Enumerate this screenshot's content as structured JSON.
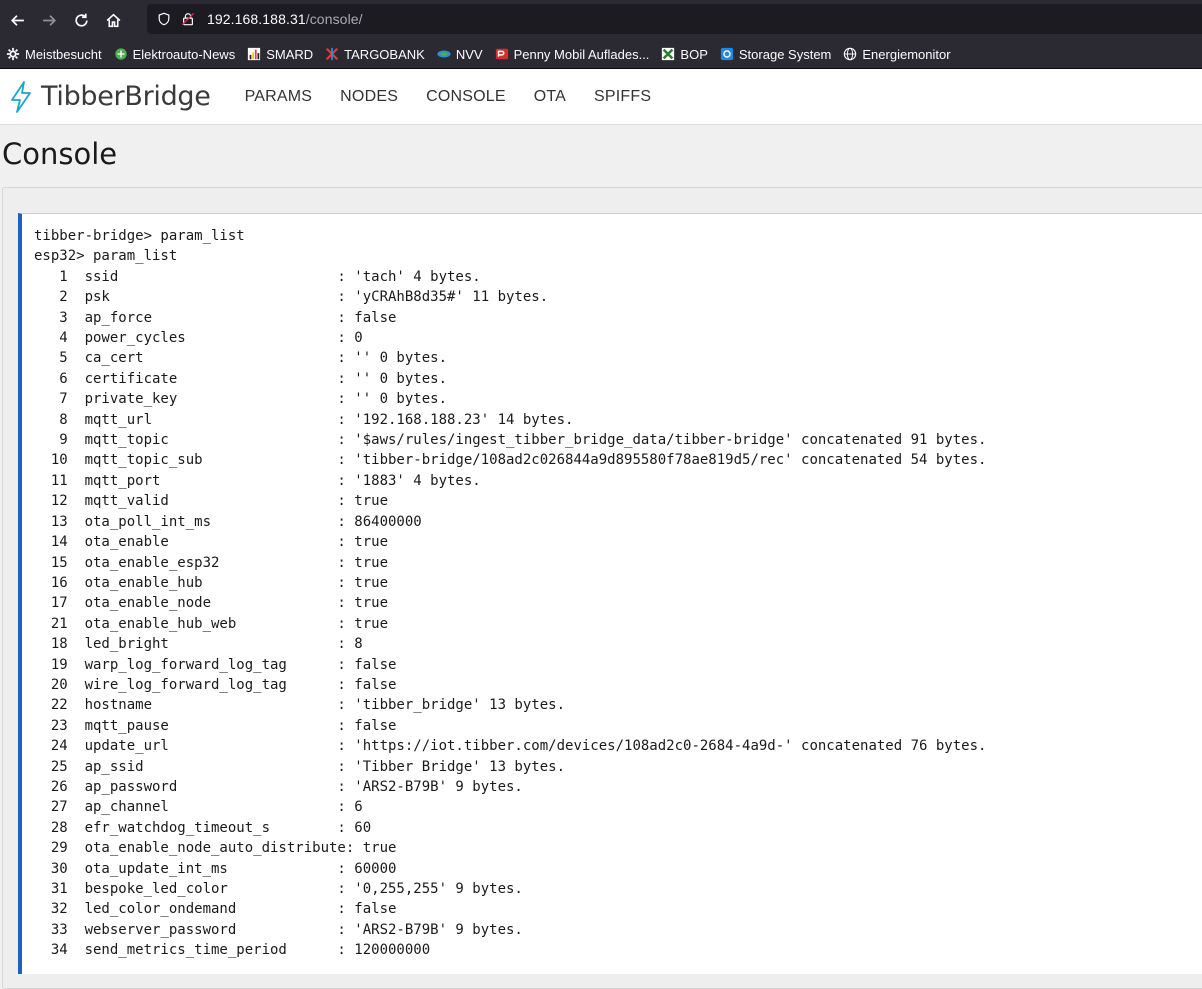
{
  "browser": {
    "url_host": "192.168.188.31",
    "url_path": "/console/",
    "bookmarks": [
      {
        "label": "Meistbesucht",
        "icon": "gear-icon",
        "color": "#fbfbfe"
      },
      {
        "label": "Elektroauto-News",
        "icon": "globe-icon",
        "color": "#4caf50"
      },
      {
        "label": "SMARD",
        "icon": "chart-icon",
        "color": "#f5c518"
      },
      {
        "label": "TARGOBANK",
        "icon": "bank-icon",
        "color": "#e23c3c"
      },
      {
        "label": "NVV",
        "icon": "bus-icon",
        "color": "#2a8fd8"
      },
      {
        "label": "Penny Mobil Auflades...",
        "icon": "penny-icon",
        "color": "#d32f2f"
      },
      {
        "label": "BOP",
        "icon": "bop-icon",
        "color": "#2e7d32"
      },
      {
        "label": "Storage System",
        "icon": "storage-icon",
        "color": "#1e88e5"
      },
      {
        "label": "Energiemonitor",
        "icon": "globe-icon",
        "color": "#fbfbfe"
      }
    ]
  },
  "app": {
    "brand": "TibberBridge",
    "nav": [
      "PARAMS",
      "NODES",
      "CONSOLE",
      "OTA",
      "SPIFFS"
    ],
    "page_title": "Console"
  },
  "console": {
    "lines": [
      "tibber-bridge> param_list",
      "esp32> param_list",
      "   1  ssid                          : 'tach' 4 bytes.",
      "   2  psk                           : 'yCRAhB8d35#' 11 bytes.",
      "   3  ap_force                      : false",
      "   4  power_cycles                  : 0",
      "   5  ca_cert                       : '' 0 bytes.",
      "   6  certificate                   : '' 0 bytes.",
      "   7  private_key                   : '' 0 bytes.",
      "   8  mqtt_url                      : '192.168.188.23' 14 bytes.",
      "   9  mqtt_topic                    : '$aws/rules/ingest_tibber_bridge_data/tibber-bridge' concatenated 91 bytes.",
      "  10  mqtt_topic_sub                : 'tibber-bridge/108ad2c026844a9d895580f78ae819d5/rec' concatenated 54 bytes.",
      "  11  mqtt_port                     : '1883' 4 bytes.",
      "  12  mqtt_valid                    : true",
      "  13  ota_poll_int_ms               : 86400000",
      "  14  ota_enable                    : true",
      "  15  ota_enable_esp32              : true",
      "  16  ota_enable_hub                : true",
      "  17  ota_enable_node               : true",
      "  21  ota_enable_hub_web            : true",
      "  18  led_bright                    : 8",
      "  19  warp_log_forward_log_tag      : false",
      "  20  wire_log_forward_log_tag      : false",
      "  22  hostname                      : 'tibber_bridge' 13 bytes.",
      "  23  mqtt_pause                    : false",
      "  24  update_url                    : 'https://iot.tibber.com/devices/108ad2c0-2684-4a9d-' concatenated 76 bytes.",
      "  25  ap_ssid                       : 'Tibber Bridge' 13 bytes.",
      "  26  ap_password                   : 'ARS2-B79B' 9 bytes.",
      "  27  ap_channel                    : 6",
      "  28  efr_watchdog_timeout_s        : 60",
      "  29  ota_enable_node_auto_distribute: true",
      "  30  ota_update_int_ms             : 60000",
      "  31  bespoke_led_color             : '0,255,255' 9 bytes.",
      "  32  led_color_ondemand            : false",
      "  33  webserver_password            : 'ARS2-B79B' 9 bytes.",
      "  34  send_metrics_time_period      : 120000000"
    ]
  }
}
